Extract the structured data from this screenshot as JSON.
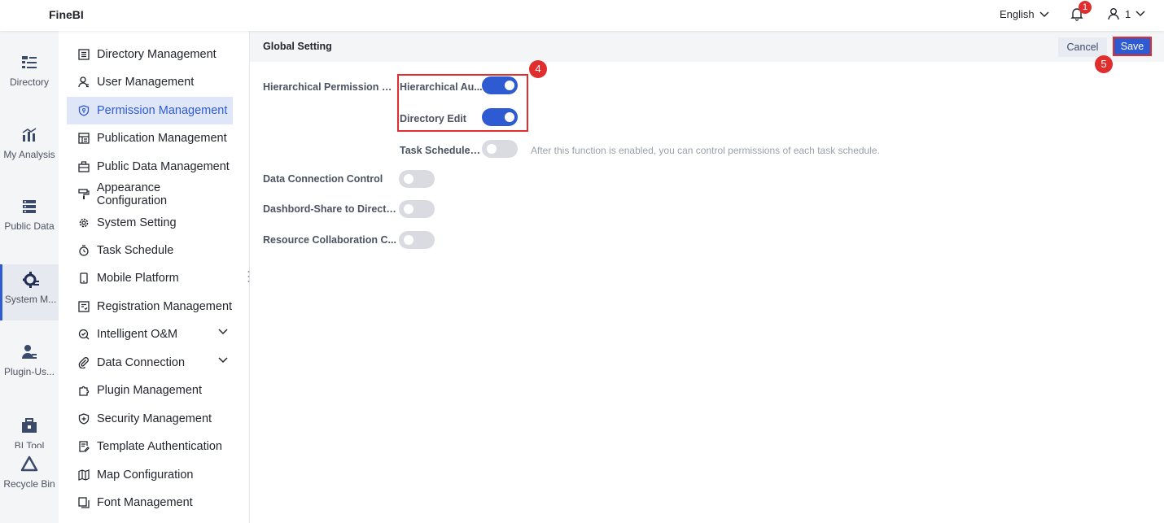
{
  "app": {
    "logo": "FineBI"
  },
  "topbar": {
    "language": "English",
    "notification_count": "1",
    "user_name": "1"
  },
  "rail": [
    {
      "label": "Directory",
      "icon": "directory-icon"
    },
    {
      "label": "My Analysis",
      "icon": "analysis-icon"
    },
    {
      "label": "Public Data",
      "icon": "public-data-icon"
    },
    {
      "label": "System M...",
      "icon": "system-management-icon",
      "active": true
    },
    {
      "label": "Plugin-Us...",
      "icon": "plugin-user-icon"
    },
    {
      "label": "BI Tool",
      "icon": "toolbox-icon"
    },
    {
      "label": "Recycle Bin",
      "icon": "recycle-bin-icon"
    }
  ],
  "menu": [
    {
      "label": "Directory Management",
      "icon": "list-icon"
    },
    {
      "label": "User Management",
      "icon": "user-icon"
    },
    {
      "label": "Permission Management",
      "icon": "shield-icon",
      "active": true
    },
    {
      "label": "Publication Management",
      "icon": "publication-icon"
    },
    {
      "label": "Public Data Management",
      "icon": "briefcase-icon"
    },
    {
      "label": "Appearance Configuration",
      "icon": "paint-roller-icon"
    },
    {
      "label": "System Setting",
      "icon": "gear-icon"
    },
    {
      "label": "Task Schedule",
      "icon": "stopwatch-icon"
    },
    {
      "label": "Mobile Platform",
      "icon": "mobile-icon"
    },
    {
      "label": "Registration Management",
      "icon": "registration-icon"
    },
    {
      "label": "Intelligent O&M",
      "icon": "om-icon",
      "expandable": true
    },
    {
      "label": "Data Connection",
      "icon": "paperclip-icon",
      "expandable": true
    },
    {
      "label": "Plugin Management",
      "icon": "puzzle-icon"
    },
    {
      "label": "Security Management",
      "icon": "shield-plus-icon"
    },
    {
      "label": "Template Authentication",
      "icon": "template-auth-icon"
    },
    {
      "label": "Map Configuration",
      "icon": "map-icon"
    },
    {
      "label": "Font Management",
      "icon": "font-icon"
    }
  ],
  "content": {
    "title": "Global Setting",
    "cancel_label": "Cancel",
    "save_label": "Save",
    "settings": {
      "hierarchical_permission": "Hierarchical Permission M...",
      "hierarchical_auth": "Hierarchical Au...",
      "directory_edit": "Directory Edit",
      "task_schedule": "Task Schedule ...",
      "task_schedule_hint": "After this function is enabled, you can control permissions of each task schedule.",
      "data_connection_control": "Data Connection Control",
      "dashboard_share": "Dashbord-Share to Directo...",
      "resource_collab": "Resource Collaboration C..."
    },
    "toggle_states": {
      "hierarchical_auth": true,
      "directory_edit": true,
      "task_schedule": false,
      "data_connection_control": false,
      "dashboard_share": false,
      "resource_collab": false
    },
    "step_markers": [
      "4",
      "5"
    ]
  },
  "colors": {
    "accent": "#2f5bd2",
    "highlight_red": "#e02d2d"
  }
}
